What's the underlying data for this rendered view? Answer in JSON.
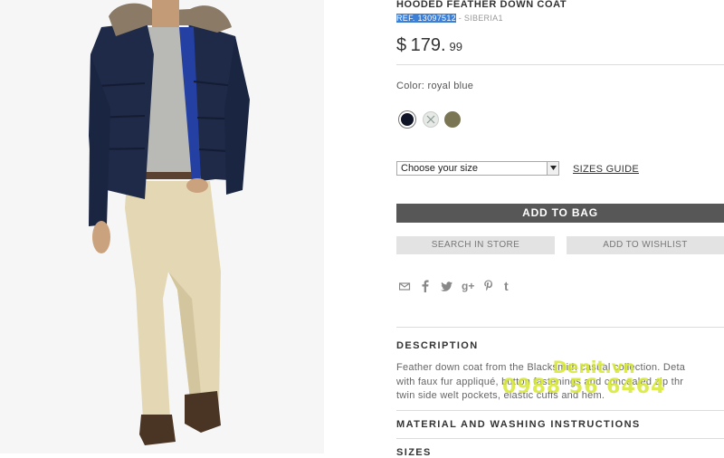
{
  "product": {
    "name": "HOODED FEATHER DOWN COAT",
    "ref_highlight": "REF. 13097512",
    "ref_rest": " - SIBERIA1",
    "price_currency": "$",
    "price_amount": "179.",
    "price_cents": "99",
    "color_label": "Color: royal blue"
  },
  "colors": {
    "swatches": [
      {
        "name": "navy",
        "hex": "#0f1427"
      },
      {
        "name": "light-grey",
        "hex": "#e6e9e6"
      },
      {
        "name": "olive",
        "hex": "#7a7552"
      }
    ],
    "selected": "navy"
  },
  "size": {
    "placeholder": "Choose your size",
    "guide_link": "SIZES GUIDE"
  },
  "actions": {
    "add_to_bag": "ADD TO BAG",
    "search_in_store": "SEARCH IN STORE",
    "add_to_wishlist": "ADD TO WISHLIST"
  },
  "share_icons": [
    "mail-icon",
    "facebook-icon",
    "twitter-icon",
    "google-plus-icon",
    "pinterest-icon",
    "tumblr-icon"
  ],
  "sections": {
    "description_heading": "DESCRIPTION",
    "description_lines": [
      "Feather down coat from the Blacksmith casual collection. Deta",
      "with faux fur appliqué, button fastenings and concealed zip thr",
      "twin side welt pockets, elastic cuffs and hem."
    ],
    "material_heading": "MATERIAL AND WASHING INSTRUCTIONS",
    "sizes_heading": "SIZES"
  },
  "watermark": {
    "line1": "Denit.vn",
    "line2": "0988 56 6464"
  }
}
